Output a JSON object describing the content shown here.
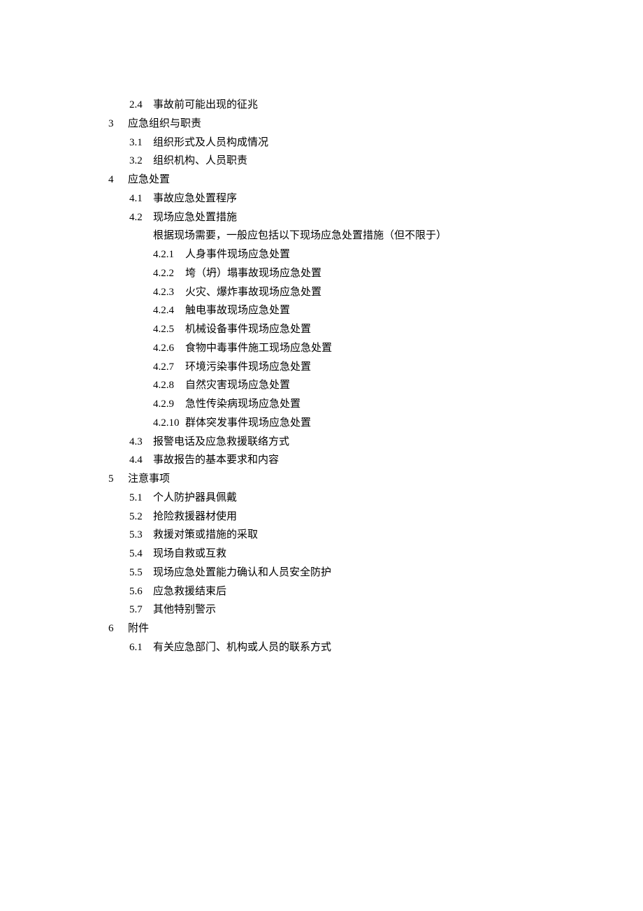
{
  "outline": {
    "i_2_4": {
      "num": "2.4",
      "text": "事故前可能出现的征兆"
    },
    "s3": {
      "num": "3",
      "text": "应急组织与职责"
    },
    "i_3_1": {
      "num": "3.1",
      "text": "组织形式及人员构成情况"
    },
    "i_3_2": {
      "num": "3.2",
      "text": "组织机构、人员职责"
    },
    "s4": {
      "num": "4",
      "text": "应急处置"
    },
    "i_4_1": {
      "num": "4.1",
      "text": "事故应急处置程序"
    },
    "i_4_2": {
      "num": "4.2",
      "text": "现场应急处置措施"
    },
    "i_4_2_note": "根据现场需要，一般应包括以下现场应急处置措施（但不限于）",
    "i_4_2_1": {
      "num": "4.2.1",
      "text": "人身事件现场应急处置"
    },
    "i_4_2_2": {
      "num": "4.2.2",
      "text": "垮（坍）塌事故现场应急处置"
    },
    "i_4_2_3": {
      "num": "4.2.3",
      "text": "火灾、爆炸事故现场应急处置"
    },
    "i_4_2_4": {
      "num": "4.2.4",
      "text": "触电事故现场应急处置"
    },
    "i_4_2_5": {
      "num": "4.2.5",
      "text": "机械设备事件现场应急处置"
    },
    "i_4_2_6": {
      "num": "4.2.6",
      "text": "食物中毒事件施工现场应急处置"
    },
    "i_4_2_7": {
      "num": "4.2.7",
      "text": "环境污染事件现场应急处置"
    },
    "i_4_2_8": {
      "num": "4.2.8",
      "text": "自然灾害现场应急处置"
    },
    "i_4_2_9": {
      "num": "4.2.9",
      "text": "急性传染病现场应急处置"
    },
    "i_4_2_10": {
      "num": "4.2.10",
      "text": "群体突发事件现场应急处置"
    },
    "i_4_3": {
      "num": "4.3",
      "text": "报警电话及应急救援联络方式"
    },
    "i_4_4": {
      "num": "4.4",
      "text": "事故报告的基本要求和内容"
    },
    "s5": {
      "num": "5",
      "text": "注意事项"
    },
    "i_5_1": {
      "num": "5.1",
      "text": "个人防护器具佩戴"
    },
    "i_5_2": {
      "num": "5.2",
      "text": "抢险救援器材使用"
    },
    "i_5_3": {
      "num": "5.3",
      "text": "救援对策或措施的采取"
    },
    "i_5_4": {
      "num": "5.4",
      "text": "现场自救或互救"
    },
    "i_5_5": {
      "num": "5.5",
      "text": "现场应急处置能力确认和人员安全防护"
    },
    "i_5_6": {
      "num": "5.6",
      "text": "应急救援结束后"
    },
    "i_5_7": {
      "num": "5.7",
      "text": "其他特别警示"
    },
    "s6": {
      "num": "6",
      "text": "附件"
    },
    "i_6_1": {
      "num": "6.1",
      "text": "有关应急部门、机构或人员的联系方式"
    }
  }
}
